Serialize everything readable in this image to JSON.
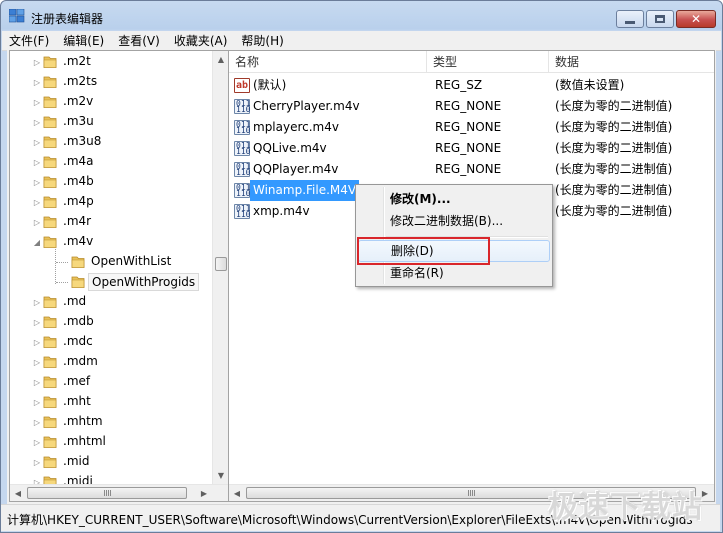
{
  "window": {
    "title": "注册表编辑器",
    "minimize_icon": "minimize-icon",
    "maximize_icon": "maximize-icon",
    "close_icon": "close-icon"
  },
  "menu": {
    "items": [
      "文件(F)",
      "编辑(E)",
      "查看(V)",
      "收藏夹(A)",
      "帮助(H)"
    ]
  },
  "tree": {
    "items": [
      {
        "label": ".m2t",
        "expander": "▷"
      },
      {
        "label": ".m2ts",
        "expander": "▷"
      },
      {
        "label": ".m2v",
        "expander": "▷"
      },
      {
        "label": ".m3u",
        "expander": "▷"
      },
      {
        "label": ".m3u8",
        "expander": "▷"
      },
      {
        "label": ".m4a",
        "expander": "▷"
      },
      {
        "label": ".m4b",
        "expander": "▷"
      },
      {
        "label": ".m4p",
        "expander": "▷"
      },
      {
        "label": ".m4r",
        "expander": "▷"
      },
      {
        "label": ".m4v",
        "expander": "◢"
      },
      {
        "label": "OpenWithList",
        "expander": ""
      },
      {
        "label": "OpenWithProgids",
        "expander": ""
      },
      {
        "label": ".md",
        "expander": "▷"
      },
      {
        "label": ".mdb",
        "expander": "▷"
      },
      {
        "label": ".mdc",
        "expander": "▷"
      },
      {
        "label": ".mdm",
        "expander": "▷"
      },
      {
        "label": ".mef",
        "expander": "▷"
      },
      {
        "label": ".mht",
        "expander": "▷"
      },
      {
        "label": ".mhtm",
        "expander": "▷"
      },
      {
        "label": ".mhtml",
        "expander": "▷"
      },
      {
        "label": ".mid",
        "expander": "▷"
      },
      {
        "label": ".midi",
        "expander": "▷"
      }
    ],
    "selected": "OpenWithProgids"
  },
  "list": {
    "headers": {
      "name": "名称",
      "type": "类型",
      "data": "数据"
    },
    "rows": [
      {
        "name": "(默认)",
        "type": "REG_SZ",
        "data": "(数值未设置)",
        "icon": "string-value-icon"
      },
      {
        "name": "CherryPlayer.m4v",
        "type": "REG_NONE",
        "data": "(长度为零的二进制值)",
        "icon": "binary-value-icon"
      },
      {
        "name": "mplayerc.m4v",
        "type": "REG_NONE",
        "data": "(长度为零的二进制值)",
        "icon": "binary-value-icon"
      },
      {
        "name": "QQLive.m4v",
        "type": "REG_NONE",
        "data": "(长度为零的二进制值)",
        "icon": "binary-value-icon"
      },
      {
        "name": "QQPlayer.m4v",
        "type": "REG_NONE",
        "data": "(长度为零的二进制值)",
        "icon": "binary-value-icon"
      },
      {
        "name": "Winamp.File.M4V",
        "type": "",
        "data": "(长度为零的二进制值)",
        "icon": "binary-value-icon",
        "selected": true
      },
      {
        "name": "xmp.m4v",
        "type": "",
        "data": "(长度为零的二进制值)",
        "icon": "binary-value-icon"
      }
    ]
  },
  "context_menu": {
    "modify": "修改(M)...",
    "modify_binary": "修改二进制数据(B)...",
    "delete": "删除(D)",
    "rename": "重命名(R)"
  },
  "status": {
    "path": "计算机\\HKEY_CURRENT_USER\\Software\\Microsoft\\Windows\\CurrentVersion\\Explorer\\FileExts\\.m4v\\OpenWithProgids"
  },
  "watermark": "极速下载站",
  "colors": {
    "selection": "#3399ff",
    "highlight_box": "#d9262b",
    "folder": "#e8c15a"
  }
}
